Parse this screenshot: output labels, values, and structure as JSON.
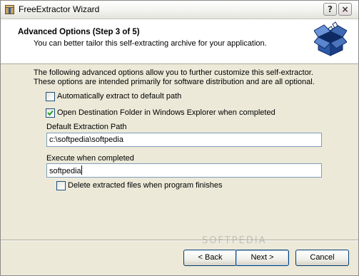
{
  "window": {
    "title": "FreeExtractor Wizard",
    "help_glyph": "?",
    "close_glyph": "×"
  },
  "header": {
    "title": "Advanced Options (Step 3 of 5)",
    "subtitle": "You can better tailor this self-extracting archive for your application."
  },
  "content": {
    "intro_line1": "The following advanced options allow you to further customize this self-extractor.",
    "intro_line2": "These options are intended primarily for software distribution and are all optional.",
    "auto_extract": {
      "label": "Automatically extract to default path",
      "checked": false
    },
    "open_folder": {
      "label": "Open Destination Folder in Windows Explorer when completed",
      "checked": true
    },
    "default_path": {
      "label": "Default Extraction Path",
      "value": "c:\\softpedia\\softpedia"
    },
    "execute": {
      "label": "Execute when completed",
      "value": "softpedia"
    },
    "delete_files": {
      "label": "Delete extracted files when program finishes",
      "checked": false
    }
  },
  "buttons": {
    "back": "< Back",
    "next": "Next >",
    "cancel": "Cancel"
  },
  "watermark": "SOFTPEDIA"
}
